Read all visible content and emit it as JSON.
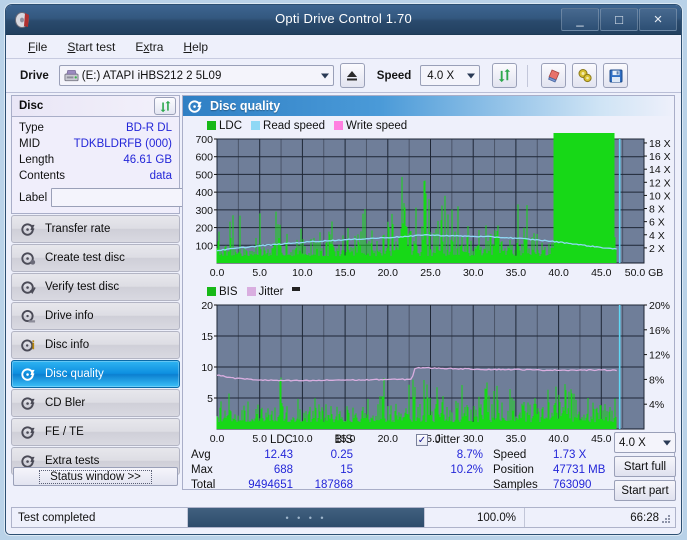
{
  "window": {
    "title": "Opti Drive Control 1.70",
    "app_icon": "disc-icon",
    "minimize": "_",
    "maximize": "□",
    "close": "×"
  },
  "menu": [
    {
      "label": "File",
      "accel": "F"
    },
    {
      "label": "Start test",
      "accel": "S"
    },
    {
      "label": "Extra",
      "accel": "x"
    },
    {
      "label": "Help",
      "accel": "H"
    }
  ],
  "toolbar": {
    "drive_label": "Drive",
    "drive_value": "(E:)  ATAPI iHBS212  2 5L09",
    "eject_icon": "eject-icon",
    "speed_label": "Speed",
    "speed_value": "4.0 X",
    "refresh_icon": "refresh-icon",
    "erase_icon": "eraser-icon",
    "settings_icon": "gears-icon",
    "save_icon": "floppy-save-icon"
  },
  "disc_panel": {
    "title": "Disc",
    "refresh_icon": "refresh-icon",
    "rows": [
      {
        "key": "Type",
        "value": "BD-R DL"
      },
      {
        "key": "MID",
        "value": "TDKBLDRFB (000)"
      },
      {
        "key": "Length",
        "value": "46.61 GB"
      },
      {
        "key": "Contents",
        "value": "data"
      }
    ],
    "label_key": "Label",
    "label_value": "",
    "label_placeholder": "",
    "label_button_icon": "cd-disc-icon"
  },
  "nav": {
    "items": [
      {
        "label": "Transfer rate",
        "icon": "disc-test-icon",
        "active": false
      },
      {
        "label": "Create test disc",
        "icon": "disc-burn-icon",
        "active": false
      },
      {
        "label": "Verify test disc",
        "icon": "disc-verify-icon",
        "active": false
      },
      {
        "label": "Drive info",
        "icon": "drive-info-icon",
        "active": false
      },
      {
        "label": "Disc info",
        "icon": "disc-info-icon",
        "active": false
      },
      {
        "label": "Disc quality",
        "icon": "disc-quality-icon",
        "active": true
      },
      {
        "label": "CD Bler",
        "icon": "cd-bler-icon",
        "active": false
      },
      {
        "label": "FE / TE",
        "icon": "fe-te-icon",
        "active": false
      },
      {
        "label": "Extra tests",
        "icon": "extra-tests-icon",
        "active": false
      }
    ],
    "status_window_button": "Status window >>"
  },
  "main": {
    "header_title": "Disc quality",
    "header_icon": "disc-quality-icon"
  },
  "stats": {
    "col_ldc": "LDC",
    "col_bis": "BIS",
    "jitter_label": "Jitter",
    "jitter_checked": true,
    "row_avg": "Avg",
    "row_max": "Max",
    "row_total": "Total",
    "ldc_avg": "12.43",
    "ldc_max": "688",
    "ldc_total": "9494651",
    "bis_avg": "0.25",
    "bis_max": "15",
    "bis_total": "187868",
    "jitter_avg": "8.7%",
    "jitter_max": "10.2%",
    "speed_key": "Speed",
    "speed_value": "1.73 X",
    "position_key": "Position",
    "position_value": "47731 MB",
    "samples_key": "Samples",
    "samples_value": "763090",
    "speed_select": "4.0 X",
    "start_full": "Start full",
    "start_part": "Start part"
  },
  "statusbar": {
    "text": "Test completed",
    "percent": "100.0%",
    "progress": 100,
    "time": "66:28",
    "dots": "• • • •"
  },
  "colors": {
    "ldc_green": "#17d817",
    "read_speed": "#8fd8f5",
    "write_speed": "#ff7fe0",
    "bis_green": "#17d817",
    "jitter_pink": "#d9aee0",
    "plot_bg": "#6f7e99",
    "grid": "#2b3245",
    "value_blue": "#2326d8",
    "accent": "#0d8fe0",
    "cursor_cyan": "#5fd8f5"
  },
  "chart_data": [
    {
      "type": "area",
      "name": "disc-quality-ldc-chart",
      "title": "",
      "xlabel": "GB",
      "xlim": [
        0,
        50
      ],
      "xticks": [
        "0.0",
        "5.0",
        "10.0",
        "15.0",
        "20.0",
        "25.0",
        "30.0",
        "35.0",
        "40.0",
        "45.0",
        "50.0 GB"
      ],
      "ylabel": "LDC",
      "ylim": [
        0,
        700
      ],
      "yticks": [
        100,
        200,
        300,
        400,
        500,
        600,
        700
      ],
      "y2label": "Speed",
      "y2lim": [
        0,
        18
      ],
      "y2ticks": [
        "2 X",
        "4 X",
        "6 X",
        "8 X",
        "10 X",
        "12 X",
        "14 X",
        "16 X",
        "18 X"
      ],
      "legend": [
        {
          "name": "LDC",
          "color": "#17d817"
        },
        {
          "name": "Read speed",
          "color": "#8fd8f5"
        },
        {
          "name": "Write speed",
          "color": "#ff7fe0"
        }
      ],
      "legend_position": "top-left",
      "grid": true,
      "data_end_gb": 46.8,
      "series": [
        {
          "name": "LDC",
          "type": "spike",
          "x": [
            0.2,
            0.5,
            0.9,
            1.2,
            1.6,
            2.0,
            2.4,
            2.8,
            3.2,
            3.6,
            4.0,
            4.4,
            4.8,
            5.3,
            5.7,
            6.1,
            6.6,
            7.0,
            7.4,
            7.9,
            8.3,
            8.8,
            9.2,
            9.7,
            10.1,
            10.6,
            11.0,
            11.5,
            11.9,
            12.4,
            12.8,
            13.3,
            13.7,
            14.2,
            14.6,
            15.1,
            15.5,
            16.0,
            16.4,
            16.9,
            17.3,
            17.8,
            18.2,
            18.7,
            19.1,
            19.6,
            20.0,
            20.5,
            20.9,
            21.4,
            21.8,
            22.3,
            22.7,
            23.2,
            23.6,
            24.1,
            24.5,
            25.0,
            25.4,
            25.9,
            26.3,
            26.8,
            27.2,
            27.7,
            28.1,
            28.6,
            29.0,
            29.5,
            29.9,
            30.4,
            30.8,
            31.3,
            31.7,
            32.2,
            32.6,
            33.1,
            33.5,
            34.0,
            34.4,
            34.9,
            35.3,
            35.8,
            36.2,
            36.7,
            37.1,
            37.6,
            38.0,
            38.5,
            38.9,
            39.4,
            39.8,
            40.3,
            40.7,
            41.2,
            41.6,
            42.1,
            42.5,
            43.0,
            43.4,
            43.9,
            44.3,
            44.8,
            45.2,
            45.7,
            46.1,
            46.6
          ],
          "values": [
            390,
            120,
            310,
            90,
            425,
            160,
            80,
            350,
            70,
            60,
            120,
            95,
            355,
            130,
            70,
            110,
            85,
            320,
            260,
            105,
            380,
            95,
            110,
            245,
            150,
            90,
            175,
            130,
            300,
            95,
            110,
            425,
            140,
            120,
            340,
            160,
            200,
            110,
            250,
            180,
            590,
            140,
            210,
            160,
            175,
            230,
            330,
            250,
            480,
            300,
            690,
            350,
            300,
            260,
            400,
            290,
            660,
            340,
            380,
            300,
            450,
            320,
            460,
            280,
            390,
            250,
            300,
            230,
            260,
            210,
            290,
            180,
            250,
            170,
            450,
            200,
            240,
            160,
            260,
            190,
            300,
            210,
            440,
            230,
            300,
            180,
            250,
            160,
            200,
            150
          ]
        },
        {
          "name": "Read speed",
          "type": "line",
          "color": "#8fd8f5",
          "x": [
            0,
            2,
            5,
            8,
            11,
            14,
            17,
            20,
            23,
            24,
            26,
            29,
            32,
            35,
            38,
            41,
            44,
            46.8
          ],
          "values_x": [
            1.8,
            2.1,
            2.5,
            2.8,
            3.1,
            3.3,
            3.5,
            3.7,
            3.9,
            4.1,
            4.0,
            3.9,
            3.8,
            3.6,
            3.3,
            2.9,
            2.4,
            2.0
          ]
        }
      ]
    },
    {
      "type": "area",
      "name": "disc-quality-bis-jitter-chart",
      "title": "",
      "xlabel": "GB",
      "xlim": [
        0,
        50
      ],
      "xticks": [
        "0.0",
        "5.0",
        "10.0",
        "15.0",
        "20.0",
        "25.0",
        "30.0",
        "35.0",
        "40.0",
        "45.0",
        "50.0 GB"
      ],
      "ylabel": "BIS",
      "ylim": [
        0,
        20
      ],
      "yticks": [
        5,
        10,
        15,
        20
      ],
      "y2label": "Jitter",
      "y2lim": [
        0,
        20
      ],
      "y2ticks": [
        "4%",
        "8%",
        "12%",
        "16%",
        "20%"
      ],
      "legend": [
        {
          "name": "BIS",
          "color": "#17d817"
        },
        {
          "name": "Jitter",
          "color": "#d9aee0"
        }
      ],
      "legend_position": "top-left",
      "grid": true,
      "data_end_gb": 46.8,
      "series": [
        {
          "name": "BIS",
          "type": "spike",
          "x": [
            0.3,
            0.8,
            1.4,
            2.0,
            2.6,
            3.2,
            3.8,
            4.4,
            5.0,
            5.6,
            6.2,
            6.8,
            7.4,
            8.0,
            8.6,
            9.2,
            9.8,
            10.4,
            11.0,
            11.6,
            12.2,
            12.8,
            13.4,
            14.0,
            14.6,
            15.2,
            15.8,
            16.4,
            17.0,
            17.6,
            18.2,
            18.8,
            19.4,
            20.0,
            20.6,
            21.2,
            21.8,
            22.4,
            23.0,
            23.6,
            24.2,
            24.8,
            25.4,
            26.0,
            26.6,
            27.2,
            27.8,
            28.4,
            29.0,
            29.6,
            30.2,
            30.8,
            31.4,
            32.0,
            32.6,
            33.2,
            33.8,
            34.4,
            35.0,
            35.6,
            36.2,
            36.8,
            37.4,
            38.0,
            38.6,
            39.2,
            39.8,
            40.4,
            41.0,
            41.6,
            42.2,
            42.8,
            43.4,
            44.0,
            44.6,
            45.2,
            45.8,
            46.4
          ],
          "values": [
            8.0,
            3.5,
            5.5,
            2.8,
            4.5,
            3.0,
            7.0,
            3.5,
            5.0,
            2.5,
            4.0,
            3.2,
            7.5,
            4.0,
            3.0,
            5.5,
            2.8,
            6.2,
            3.5,
            4.5,
            3.0,
            5.0,
            3.5,
            6.5,
            4.0,
            5.5,
            3.2,
            4.8,
            3.0,
            5.5,
            4.0,
            3.5,
            12.1,
            4.5,
            3.0,
            5.0,
            3.5,
            8.0,
            6.5,
            5.0,
            12.2,
            7.0,
            5.5,
            15.1,
            6.0,
            7.5,
            5.0,
            6.5,
            14.1,
            5.5,
            7.0,
            6.0,
            8.0,
            11.0,
            6.5,
            7.5,
            5.0,
            6.5,
            5.5,
            7.0,
            6.0,
            8.5,
            5.5,
            6.5,
            5.0,
            7.0,
            5.5,
            9.0,
            6.0,
            7.5,
            5.0,
            6.5,
            8.5,
            5.5,
            7.0,
            6.0,
            5.5,
            5.0
          ]
        },
        {
          "name": "Jitter",
          "type": "line",
          "color": "#d9aee0",
          "x": [
            0,
            2,
            5,
            8,
            11,
            14,
            17,
            20,
            22.8,
            23.2,
            26,
            29,
            32,
            35,
            38,
            41,
            44,
            46.8
          ],
          "values_pct": [
            8.7,
            8.2,
            7.9,
            7.8,
            7.8,
            7.9,
            7.9,
            8.0,
            8.0,
            9.9,
            9.8,
            9.7,
            9.6,
            9.6,
            9.5,
            9.5,
            9.5,
            9.5
          ]
        }
      ]
    }
  ]
}
